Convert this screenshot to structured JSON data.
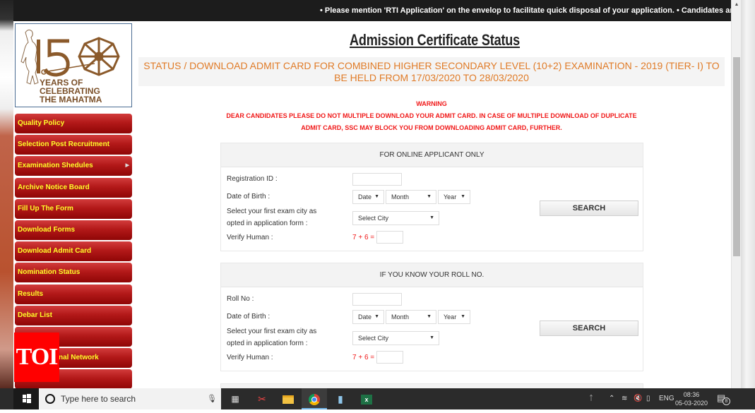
{
  "ticker": {
    "text": "• Please mention 'RTI Application' on the envelop to facilitate quick disposal of your application.  • Candidates are a"
  },
  "logo": {
    "number": "150",
    "line1": "YEARS OF",
    "line2": "CELEBRATING",
    "line3": "THE MAHATMA",
    "color": "#8b5a2b"
  },
  "page": {
    "title": "Admission Certificate Status",
    "status_banner": "STATUS / DOWNLOAD ADMIT CARD FOR COMBINED HIGHER SECONDARY LEVEL (10+2) EXAMINATION - 2019 (TIER- I) TO BE HELD FROM 17/03/2020 TO 28/03/2020",
    "warning_title": "WARNING",
    "warning_line1": "DEAR CANDIDATES PLEASE DO NOT MULTIPLE DOWNLOAD YOUR ADMIT CARD. IN CASE OF MULTIPLE DOWNLOAD OF DUPLICATE",
    "warning_line2": "ADMIT CARD, SSC MAY BLOCK YOU FROM DOWNLOADING ADMIT CARD, FURTHER."
  },
  "sidebar": {
    "items": [
      {
        "label": "Quality Policy"
      },
      {
        "label": "Selection Post Recruitment"
      },
      {
        "label": "Examination Shedules",
        "has_submenu": true
      },
      {
        "label": "Archive Notice Board"
      },
      {
        "label": "Fill Up The Form"
      },
      {
        "label": "Download Forms"
      },
      {
        "label": "Download Admit Card"
      },
      {
        "label": "Nomination Status"
      },
      {
        "label": "Results"
      },
      {
        "label": "Debar List"
      },
      {
        "label": ""
      },
      {
        "label": "nal Network"
      },
      {
        "label": ""
      }
    ]
  },
  "watermark": {
    "text": "TOI"
  },
  "forms": [
    {
      "heading": "FOR ONLINE APPLICANT ONLY",
      "id_label": "Registration ID :",
      "id_value": "",
      "dob_label": "Date of Birth :",
      "date_select": "Date",
      "month_select": "Month",
      "year_select": "Year",
      "city_label_1": "Select your first exam city as",
      "city_label_2": "opted in application form :",
      "city_select": "Select City",
      "verify_label": "Verify Human :",
      "captcha": "7 + 6 =",
      "captcha_value": "",
      "button": "SEARCH"
    },
    {
      "heading": "IF YOU KNOW YOUR ROLL NO.",
      "id_label": "Roll No :",
      "id_value": "",
      "dob_label": "Date of Birth :",
      "date_select": "Date",
      "month_select": "Month",
      "year_select": "Year",
      "city_label_1": "Select your first exam city as",
      "city_label_2": "opted in application form :",
      "city_select": "Select City",
      "verify_label": "Verify Human :",
      "captcha": "7 + 6 =",
      "captcha_value": "",
      "button": "SEARCH"
    }
  ],
  "taskbar": {
    "search_placeholder": "Type here to search",
    "language": "ENG",
    "time": "08:36",
    "date": "05-03-2020",
    "notification_count": "8"
  },
  "colors": {
    "menu_red": "#b31919",
    "menu_text": "#ffff2a",
    "banner_orange": "#e07b27",
    "warning_red": "#f01818"
  }
}
